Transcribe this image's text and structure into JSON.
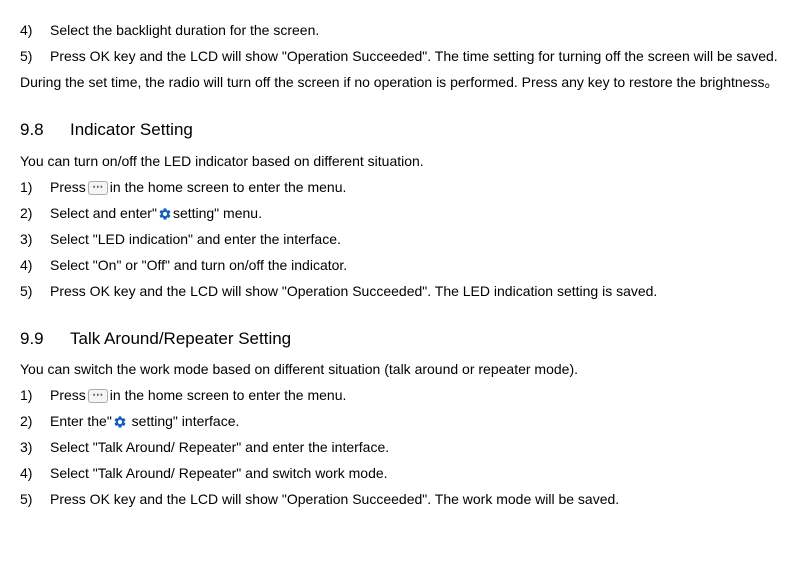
{
  "prior_section": {
    "step4": {
      "num": "4)",
      "text": "Select the backlight duration for the screen."
    },
    "step5": {
      "num": "5)",
      "text": "Press OK key and the LCD will show \"Operation Succeeded\". The time setting for turning off the screen will be saved."
    },
    "note": "During the set time, the radio will turn off the screen if no operation is performed. Press any key to restore the brightness。"
  },
  "section_98": {
    "num": "9.8",
    "title": "Indicator Setting",
    "intro": "You can turn on/off the LED indicator based on different situation.",
    "step1": {
      "num": "1)",
      "before": "Press",
      "after": "in the home screen to enter the menu."
    },
    "step2": {
      "num": "2)",
      "before": "Select and enter\"",
      "after": "setting\" menu."
    },
    "step3": {
      "num": "3)",
      "text": "Select \"LED indication\" and enter the interface."
    },
    "step4": {
      "num": "4)",
      "text": "Select \"On\" or \"Off\" and turn on/off the indicator."
    },
    "step5": {
      "num": "5)",
      "text": "Press OK key and the LCD will show \"Operation Succeeded\". The LED indication setting is saved."
    }
  },
  "section_99": {
    "num": "9.9",
    "title": "Talk Around/Repeater Setting",
    "intro": "You can switch the work mode based on different situation (talk around or repeater mode).",
    "step1": {
      "num": "1)",
      "before": "Press",
      "after": "in the home screen to enter the menu."
    },
    "step2": {
      "num": "2)",
      "before": "Enter the\"",
      "after": " setting\" interface."
    },
    "step3": {
      "num": "3)",
      "text": "Select \"Talk Around/ Repeater\" and enter the interface."
    },
    "step4": {
      "num": "4)",
      "text": "Select \"Talk Around/ Repeater\" and switch work mode."
    },
    "step5": {
      "num": "5)",
      "text": "Press OK key and the LCD will show \"Operation Succeeded\". The work mode will be saved."
    }
  }
}
